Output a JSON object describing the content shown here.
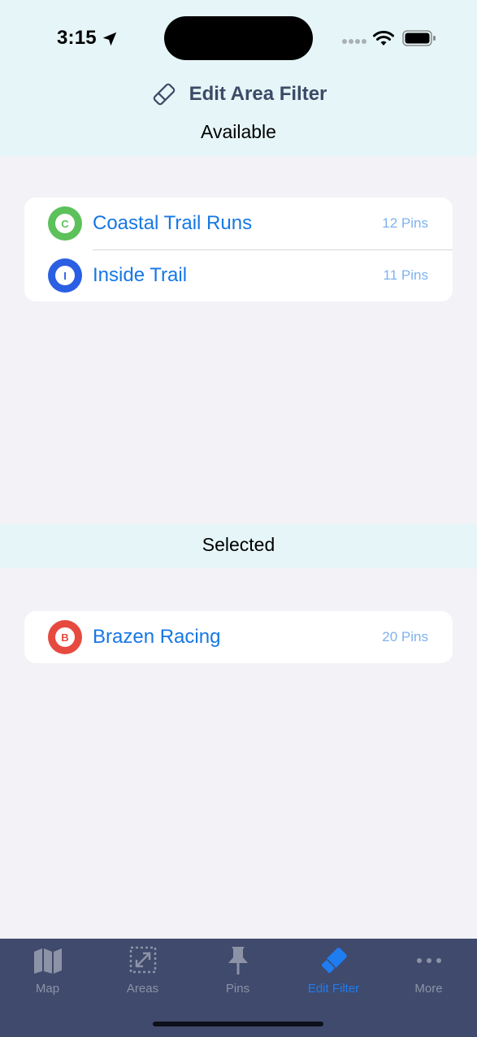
{
  "status": {
    "time": "3:15",
    "icons": [
      "location-arrow-icon",
      "signal-dots-icon",
      "wifi-icon",
      "battery-icon"
    ]
  },
  "header": {
    "title": "Edit Area Filter",
    "icon": "eraser-icon"
  },
  "available": {
    "label": "Available",
    "items": [
      {
        "letter": "C",
        "name": "Coastal Trail Runs",
        "count": "12 Pins",
        "color": "#5cc15b"
      },
      {
        "letter": "I",
        "name": "Inside Trail",
        "count": "11 Pins",
        "color": "#2a5fe3"
      }
    ]
  },
  "selected": {
    "label": "Selected",
    "items": [
      {
        "letter": "B",
        "name": "Brazen Racing",
        "count": "20 Pins",
        "color": "#e64a3f"
      }
    ]
  },
  "tabs": [
    {
      "label": "Map",
      "icon": "map-icon",
      "active": false
    },
    {
      "label": "Areas",
      "icon": "areas-resize-icon",
      "active": false
    },
    {
      "label": "Pins",
      "icon": "pushpin-icon",
      "active": false
    },
    {
      "label": "Edit Filter",
      "icon": "eraser-icon",
      "active": true
    },
    {
      "label": "More",
      "icon": "ellipsis-icon",
      "active": false
    }
  ],
  "colors": {
    "accent": "#1677e5",
    "header_bg": "#e6f6f8",
    "tabbar_bg": "#3f4a6d",
    "tab_active": "#1f7df2"
  }
}
